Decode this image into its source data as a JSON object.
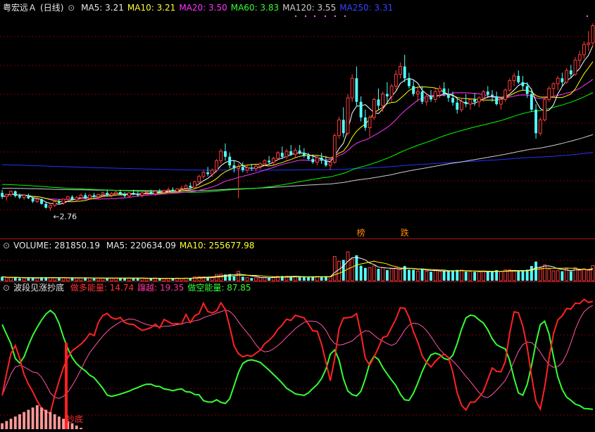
{
  "stock": {
    "name": "粤宏远Ａ",
    "period": "(日线)"
  },
  "colors": {
    "ma5": "#ffffff",
    "ma10": "#ffff00",
    "ma20": "#ff33ff",
    "ma60": "#00ff00",
    "ma120": "#cccccc",
    "ma250": "#2233ff",
    "up": "#ff3b3b",
    "down": "#54ffff",
    "bull": "#ff2222",
    "bear": "#33ff33",
    "cross": "#ff55aa",
    "grid": "#7a0000"
  },
  "price_panel": {
    "ma_labels": [
      {
        "id": "ma5",
        "text": "MA5: 3.21",
        "color": "#e8e8e8"
      },
      {
        "id": "ma10",
        "text": "MA10: 3.21",
        "color": "#ffff33"
      },
      {
        "id": "ma20",
        "text": "MA20: 3.50",
        "color": "#ff33ff"
      },
      {
        "id": "ma60",
        "text": "MA60: 3.83",
        "color": "#33ff33"
      },
      {
        "id": "ma120",
        "text": "MA120: 3.55",
        "color": "#cccccc"
      },
      {
        "id": "ma250",
        "text": "MA250: 3.31",
        "color": "#3344ff"
      }
    ],
    "low_label": "2.76",
    "signals": [
      {
        "text": "榜",
        "color": "#ff8800"
      },
      {
        "text": "跌",
        "color": "#ff8800"
      }
    ]
  },
  "volume_panel": {
    "title": "VOLUME: 281850.19",
    "ma_labels": [
      {
        "id": "vma5",
        "text": "MA5: 220634.09",
        "color": "#e8e8e8"
      },
      {
        "id": "vma10",
        "text": "MA10: 255677.98",
        "color": "#ffff33"
      }
    ]
  },
  "indicator_panel": {
    "title": "波段见涨抄底",
    "labels": [
      {
        "id": "bull",
        "text": "做多能量: 14.74",
        "color": "#ff3333"
      },
      {
        "id": "cross",
        "text": "蹿越: 19.35",
        "color": "#ff3399"
      },
      {
        "id": "bear",
        "text": "做空能量: 87.85",
        "color": "#33ff33"
      }
    ],
    "bottom_signal": "抄底"
  },
  "chart_data": {
    "type": "candlestick",
    "candles": [
      [
        2.99,
        3.03,
        2.91,
        2.94
      ],
      [
        2.94,
        2.98,
        2.89,
        2.97
      ],
      [
        2.97,
        3.02,
        2.94,
        3.01
      ],
      [
        3.01,
        3.02,
        2.93,
        2.95
      ],
      [
        2.95,
        2.98,
        2.91,
        2.93
      ],
      [
        2.93,
        2.97,
        2.9,
        2.96
      ],
      [
        2.96,
        2.98,
        2.91,
        2.92
      ],
      [
        2.92,
        2.94,
        2.86,
        2.88
      ],
      [
        2.88,
        2.93,
        2.86,
        2.91
      ],
      [
        2.91,
        2.92,
        2.84,
        2.85
      ],
      [
        2.85,
        2.88,
        2.79,
        2.8
      ],
      [
        2.8,
        2.84,
        2.76,
        2.83
      ],
      [
        2.83,
        2.89,
        2.81,
        2.88
      ],
      [
        2.88,
        2.91,
        2.84,
        2.86
      ],
      [
        2.86,
        2.92,
        2.84,
        2.91
      ],
      [
        2.91,
        2.95,
        2.88,
        2.94
      ],
      [
        2.94,
        2.96,
        2.89,
        2.9
      ],
      [
        2.9,
        2.95,
        2.88,
        2.93
      ],
      [
        2.93,
        2.98,
        2.91,
        2.96
      ],
      [
        2.96,
        2.99,
        2.91,
        2.92
      ],
      [
        2.92,
        2.97,
        2.9,
        2.96
      ],
      [
        2.96,
        2.99,
        2.93,
        2.94
      ],
      [
        2.94,
        2.98,
        2.91,
        2.97
      ],
      [
        2.97,
        3.01,
        2.94,
        2.99
      ],
      [
        2.99,
        3.03,
        2.95,
        2.96
      ],
      [
        2.96,
        3.0,
        2.93,
        2.98
      ],
      [
        2.98,
        3.02,
        2.95,
        3.0
      ],
      [
        3.0,
        3.03,
        2.96,
        2.97
      ],
      [
        2.97,
        3.0,
        2.93,
        2.95
      ],
      [
        2.95,
        3.0,
        2.93,
        2.99
      ],
      [
        2.99,
        3.03,
        2.96,
        2.98
      ],
      [
        2.98,
        3.01,
        2.94,
        2.96
      ],
      [
        2.96,
        3.0,
        2.93,
        2.99
      ],
      [
        2.99,
        3.02,
        2.96,
        3.0
      ],
      [
        3.0,
        3.03,
        2.97,
        2.98
      ],
      [
        2.98,
        3.02,
        2.95,
        3.01
      ],
      [
        3.01,
        3.04,
        2.98,
        3.0
      ],
      [
        3.0,
        3.03,
        2.97,
        3.02
      ],
      [
        3.02,
        3.06,
        2.99,
        3.03
      ],
      [
        3.03,
        3.06,
        3.0,
        3.01
      ],
      [
        3.01,
        3.05,
        2.98,
        3.04
      ],
      [
        3.04,
        3.08,
        3.01,
        3.05
      ],
      [
        3.05,
        3.1,
        3.03,
        3.08
      ],
      [
        3.08,
        3.12,
        3.04,
        3.06
      ],
      [
        3.06,
        3.14,
        3.05,
        3.13
      ],
      [
        3.13,
        3.22,
        3.11,
        3.2
      ],
      [
        3.2,
        3.28,
        3.17,
        3.25
      ],
      [
        3.25,
        3.32,
        3.2,
        3.23
      ],
      [
        3.23,
        3.3,
        3.19,
        3.28
      ],
      [
        3.28,
        3.42,
        3.25,
        3.4
      ],
      [
        3.4,
        3.55,
        3.36,
        3.52
      ],
      [
        3.52,
        3.62,
        3.4,
        3.45
      ],
      [
        3.45,
        3.5,
        3.3,
        3.34
      ],
      [
        3.34,
        3.4,
        3.25,
        3.3
      ],
      [
        3.3,
        3.36,
        2.92,
        3.32
      ],
      [
        3.32,
        3.38,
        3.25,
        3.28
      ],
      [
        3.28,
        3.34,
        3.24,
        3.31
      ],
      [
        3.31,
        3.36,
        3.27,
        3.3
      ],
      [
        3.3,
        3.35,
        3.26,
        3.33
      ],
      [
        3.33,
        3.38,
        3.29,
        3.36
      ],
      [
        3.36,
        3.42,
        3.33,
        3.4
      ],
      [
        3.4,
        3.46,
        3.36,
        3.38
      ],
      [
        3.38,
        3.45,
        3.35,
        3.43
      ],
      [
        3.43,
        3.52,
        3.4,
        3.5
      ],
      [
        3.5,
        3.58,
        3.42,
        3.45
      ],
      [
        3.45,
        3.55,
        3.42,
        3.52
      ],
      [
        3.52,
        3.6,
        3.46,
        3.48
      ],
      [
        3.48,
        3.56,
        3.44,
        3.53
      ],
      [
        3.53,
        3.6,
        3.48,
        3.5
      ],
      [
        3.5,
        3.56,
        3.44,
        3.46
      ],
      [
        3.46,
        3.5,
        3.4,
        3.42
      ],
      [
        3.42,
        3.48,
        3.36,
        3.38
      ],
      [
        3.38,
        3.46,
        3.34,
        3.44
      ],
      [
        3.44,
        3.5,
        3.36,
        3.4
      ],
      [
        3.4,
        3.46,
        3.32,
        3.34
      ],
      [
        3.34,
        3.4,
        3.28,
        3.38
      ],
      [
        3.38,
        3.75,
        3.36,
        3.72
      ],
      [
        3.72,
        3.96,
        3.68,
        3.92
      ],
      [
        3.92,
        4.08,
        3.7,
        3.75
      ],
      [
        3.75,
        4.25,
        3.72,
        4.2
      ],
      [
        4.2,
        4.5,
        4.15,
        4.45
      ],
      [
        4.45,
        4.6,
        4.1,
        4.15
      ],
      [
        4.15,
        4.22,
        3.9,
        3.95
      ],
      [
        3.95,
        4.05,
        3.78,
        3.82
      ],
      [
        3.82,
        3.98,
        3.7,
        3.95
      ],
      [
        3.95,
        4.2,
        3.92,
        4.18
      ],
      [
        4.18,
        4.32,
        4.05,
        4.1
      ],
      [
        4.1,
        4.28,
        4.02,
        4.25
      ],
      [
        4.25,
        4.4,
        4.15,
        4.22
      ],
      [
        4.22,
        4.38,
        4.15,
        4.35
      ],
      [
        4.35,
        4.55,
        4.3,
        4.5
      ],
      [
        4.5,
        4.65,
        4.45,
        4.6
      ],
      [
        4.6,
        4.75,
        4.4,
        4.45
      ],
      [
        4.45,
        4.52,
        4.32,
        4.35
      ],
      [
        4.35,
        4.42,
        4.22,
        4.25
      ],
      [
        4.25,
        4.35,
        4.15,
        4.28
      ],
      [
        4.28,
        4.35,
        4.12,
        4.15
      ],
      [
        4.15,
        4.25,
        4.1,
        4.22
      ],
      [
        4.22,
        4.3,
        4.15,
        4.18
      ],
      [
        4.18,
        4.32,
        4.14,
        4.28
      ],
      [
        4.28,
        4.36,
        4.2,
        4.32
      ],
      [
        4.32,
        4.4,
        4.22,
        4.25
      ],
      [
        4.25,
        4.32,
        4.15,
        4.2
      ],
      [
        4.2,
        4.28,
        4.1,
        4.14
      ],
      [
        4.14,
        4.2,
        4.0,
        4.05
      ],
      [
        4.05,
        4.2,
        4.02,
        4.15
      ],
      [
        4.15,
        4.25,
        4.08,
        4.12
      ],
      [
        4.12,
        4.2,
        4.05,
        4.18
      ],
      [
        4.18,
        4.26,
        4.1,
        4.15
      ],
      [
        4.15,
        4.22,
        4.08,
        4.2
      ],
      [
        4.2,
        4.3,
        4.15,
        4.28
      ],
      [
        4.28,
        4.35,
        4.2,
        4.24
      ],
      [
        4.24,
        4.3,
        4.15,
        4.22
      ],
      [
        4.22,
        4.28,
        4.1,
        4.12
      ],
      [
        4.12,
        4.2,
        4.05,
        4.18
      ],
      [
        4.18,
        4.32,
        4.15,
        4.3
      ],
      [
        4.3,
        4.45,
        4.28,
        4.42
      ],
      [
        4.42,
        4.52,
        4.35,
        4.48
      ],
      [
        4.48,
        4.55,
        4.38,
        4.4
      ],
      [
        4.4,
        4.48,
        4.3,
        4.35
      ],
      [
        4.35,
        4.4,
        4.2,
        4.25
      ],
      [
        4.25,
        4.32,
        4.02,
        4.05
      ],
      [
        4.05,
        4.12,
        3.68,
        3.75
      ],
      [
        3.75,
        3.95,
        3.72,
        3.92
      ],
      [
        3.92,
        4.2,
        3.9,
        4.18
      ],
      [
        4.18,
        4.35,
        4.15,
        4.32
      ],
      [
        4.32,
        4.4,
        4.22,
        4.38
      ],
      [
        4.38,
        4.48,
        4.3,
        4.45
      ],
      [
        4.45,
        4.52,
        4.35,
        4.4
      ],
      [
        4.4,
        4.58,
        4.38,
        4.55
      ],
      [
        4.55,
        4.62,
        4.45,
        4.5
      ],
      [
        4.5,
        4.72,
        4.48,
        4.68
      ],
      [
        4.68,
        4.8,
        4.6,
        4.75
      ],
      [
        4.75,
        4.92,
        4.7,
        4.88
      ],
      [
        4.88,
        5.05,
        4.8,
        4.9
      ],
      [
        4.9,
        5.15,
        4.85,
        5.12
      ]
    ]
  }
}
